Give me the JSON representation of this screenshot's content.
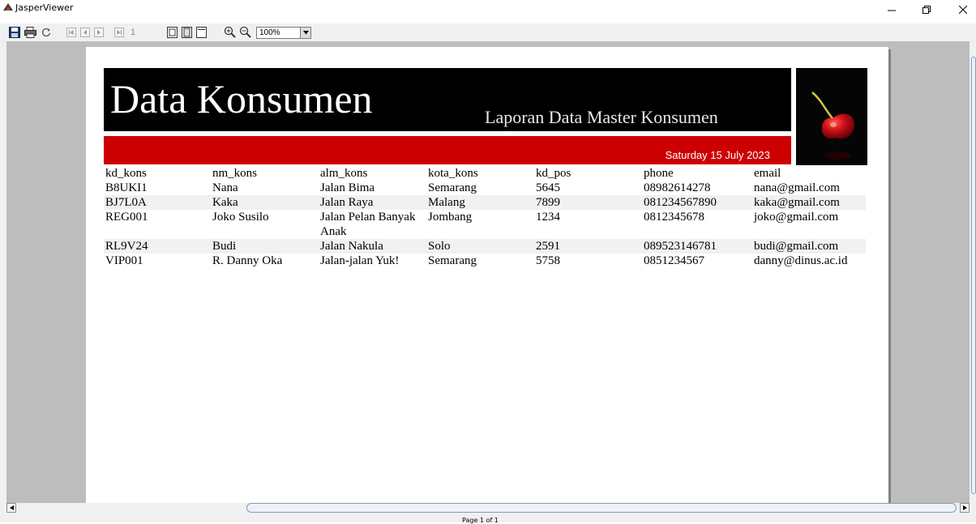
{
  "window": {
    "title": "JasperViewer",
    "controls": [
      "minimize-icon",
      "restore-icon",
      "close-icon"
    ]
  },
  "toolbar": {
    "buttons": [
      "save-icon",
      "print-icon",
      "reload-icon",
      "first-page-icon",
      "previous-page-icon",
      "next-page-icon",
      "last-page-icon",
      "actual-size-icon",
      "fit-page-icon",
      "fit-width-icon",
      "zoom-in-icon",
      "zoom-out-icon"
    ],
    "page_number": "1",
    "zoom": "100%"
  },
  "report": {
    "title": "Data Konsumen",
    "subtitle": "Laporan Data Master Konsumen",
    "date": "Saturday 15 July 2023",
    "logo": "cherry-image",
    "colors": {
      "title_band": "#000000",
      "date_band": "#cc0000",
      "alt_row": "#f1f1f1"
    },
    "columns": [
      "kd_kons",
      "nm_kons",
      "alm_kons",
      "kota_kons",
      "kd_pos",
      "phone",
      "email"
    ],
    "rows": [
      [
        "B8UKI1",
        "Nana",
        "Jalan Bima",
        "Semarang",
        "5645",
        "08982614278",
        "nana@gmail.com"
      ],
      [
        "BJ7L0A",
        "Kaka",
        "Jalan Raya",
        "Malang",
        "7899",
        "081234567890",
        "kaka@gmail.com"
      ],
      [
        "REG001",
        "Joko Susilo",
        "Jalan Pelan Banyak Anak",
        "Jombang",
        "1234",
        "0812345678",
        "joko@gmail.com"
      ],
      [
        "RL9V24",
        "Budi",
        "Jalan Nakula",
        "Solo",
        "2591",
        "089523146781",
        "budi@gmail.com"
      ],
      [
        "VIP001",
        "R. Danny Oka",
        "Jalan-jalan Yuk!",
        "Semarang",
        "5758",
        "0851234567",
        "danny@dinus.ac.id"
      ]
    ]
  },
  "status": {
    "page_label": "Page 1 of 1"
  }
}
